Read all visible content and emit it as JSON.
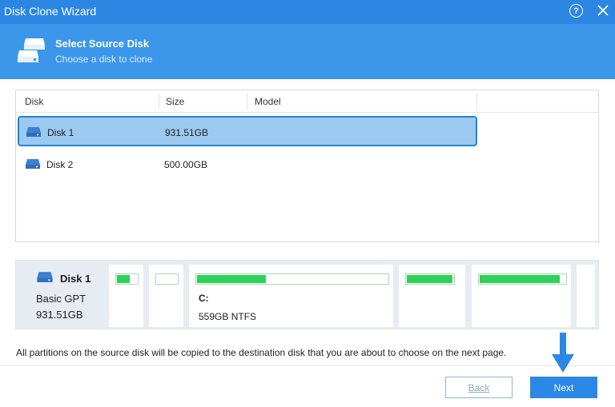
{
  "window": {
    "title": "Disk Clone Wizard"
  },
  "header": {
    "title": "Select Source Disk",
    "subtitle": "Choose a disk to clone"
  },
  "table": {
    "columns": [
      "Disk",
      "Size",
      "Model"
    ],
    "rows": [
      {
        "disk": "Disk 1",
        "size": "931.51GB",
        "model": "",
        "selected": true
      },
      {
        "disk": "Disk 2",
        "size": "500.00GB",
        "model": "",
        "selected": false
      }
    ]
  },
  "disk_map": {
    "name": "Disk 1",
    "type": "Basic GPT",
    "size": "931.51GB",
    "partitions": [
      {
        "label": "",
        "info": "",
        "used_fraction": 0.65
      },
      {
        "label": "",
        "info": "",
        "used_fraction": 0.0
      },
      {
        "label": "C:",
        "info": "559GB NTFS",
        "used_fraction": 0.36
      },
      {
        "label": "",
        "info": "",
        "used_fraction": 0.98
      },
      {
        "label": "",
        "info": "",
        "used_fraction": 0.93
      },
      {
        "label": "",
        "info": "",
        "used_fraction": 0.0
      }
    ]
  },
  "note": "All partitions on the source disk will be copied to the destination disk that you are about to choose on the next page.",
  "buttons": {
    "back": "Back",
    "next": "Next"
  },
  "colors": {
    "titlebar": "#2c87e3",
    "header": "#3c97ea",
    "selection": "#9cc9ef",
    "selection_border": "#1d86d6",
    "used_bar": "#2ed05a",
    "accent_button": "#2b88e6",
    "arrow": "#2b88e6"
  }
}
